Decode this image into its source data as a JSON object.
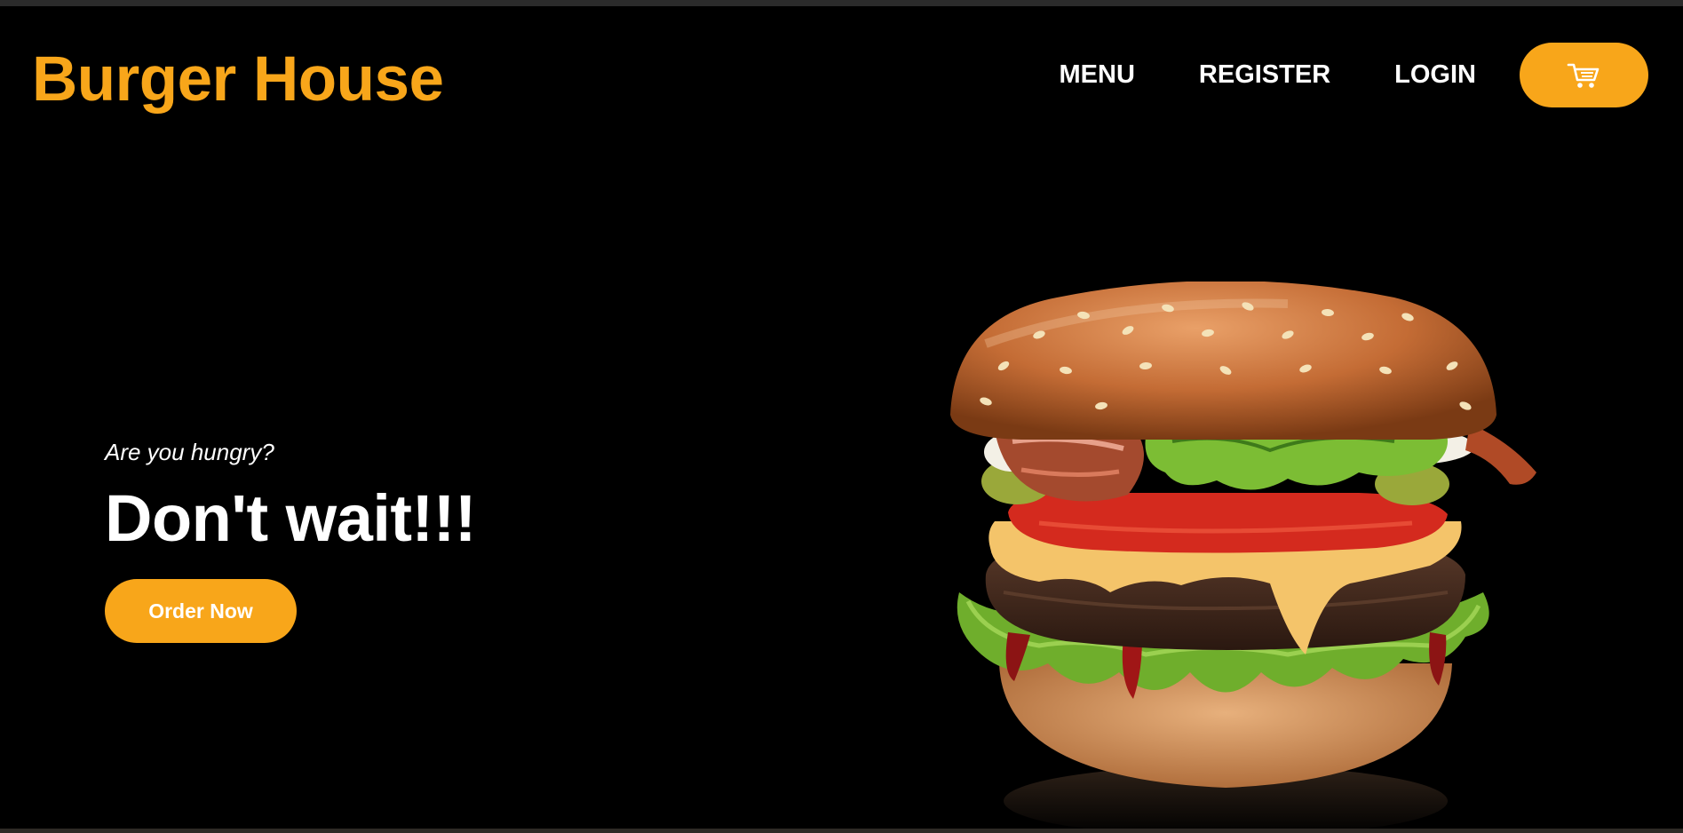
{
  "brand": {
    "name": "Burger House"
  },
  "nav": {
    "items": [
      {
        "label": "MENU"
      },
      {
        "label": "REGISTER"
      },
      {
        "label": "LOGIN"
      }
    ],
    "cart_icon": "shopping-cart-icon"
  },
  "hero": {
    "eyebrow": "Are you hungry?",
    "headline": "Don't wait!!!",
    "cta_label": "Order Now",
    "image": "burger-photo"
  },
  "colors": {
    "accent": "#f8a61a",
    "background": "#000000",
    "text": "#ffffff"
  }
}
